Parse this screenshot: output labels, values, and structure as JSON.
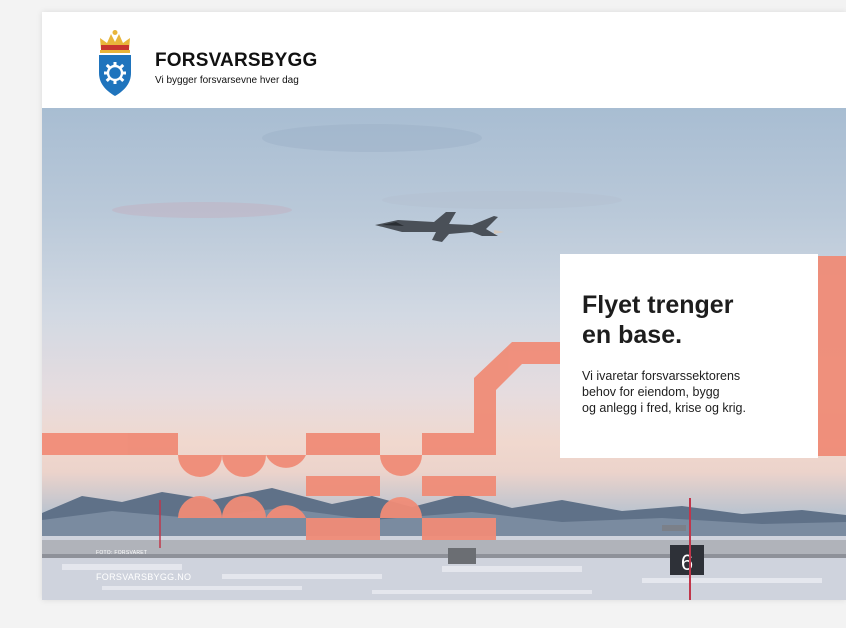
{
  "brand": {
    "name": "FORSVARSBYGG",
    "tagline": "Vi bygger forsvarsevne hver dag"
  },
  "headline": {
    "line1": "Flyet trenger",
    "line2": "en base."
  },
  "body": {
    "line1": "Vi ivaretar forsvarssektorens",
    "line2": "behov for eiendom, bygg",
    "line3": "og anlegg i fred, krise og krig."
  },
  "photo_credit": "FOTO: FORSVARET",
  "website": "FORSVARSBYGG.NO",
  "runway_sign": "6",
  "colors": {
    "accent_salmon": "#f08c77",
    "shield_blue": "#1f74bd",
    "crown_gold": "#e8b53a",
    "crown_red": "#c8352e",
    "text": "#1d1d1d"
  },
  "icons": [
    "coat-of-arms-icon",
    "fighter-jet-icon"
  ]
}
